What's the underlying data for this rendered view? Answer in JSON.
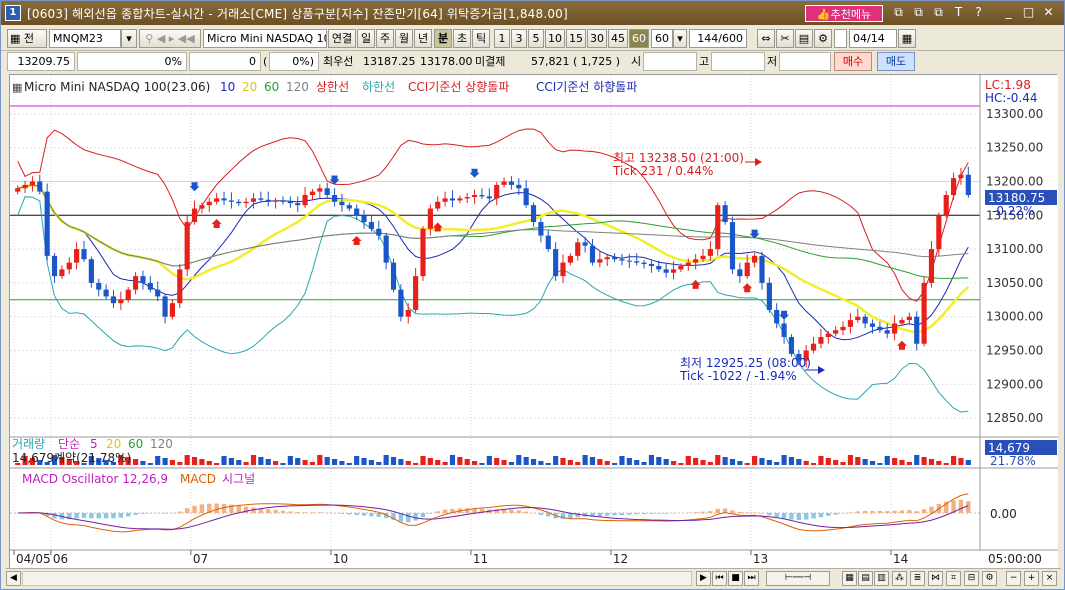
{
  "titlebar": {
    "window_num": "1",
    "title": "[0603] 해외선옵 종합차트-실시간 - 거래소[CME] 상품구분[지수] 잔존만기[64] 위탁증거금[1,848.00]",
    "recommend_label": "추천메뉴",
    "controls": [
      "⧉",
      "⧉",
      "⧉",
      "T",
      "?",
      "_",
      "□",
      "✕"
    ]
  },
  "toolbar": {
    "jeon": "전",
    "symbol": "MNQM23",
    "product_name": "Micro Mini NASDAQ 10",
    "continuous": "연결",
    "periods": [
      "일",
      "주",
      "월",
      "년",
      "분",
      "초",
      "틱"
    ],
    "intervals": [
      "1",
      "3",
      "5",
      "10",
      "15",
      "30",
      "45",
      "60"
    ],
    "selected_interval": "60",
    "interval_value": "60",
    "count": "144/600",
    "date": "04/14"
  },
  "quote": {
    "price": "13209.75",
    "change": "0%",
    "volume": "0",
    "volume_pct": "0%)",
    "paren": "(",
    "best_ask_label": "최우선",
    "best_ask": "13187.25",
    "best_bid": "13178.00",
    "open_int_label": "미결제",
    "open_int": "57,821",
    "oi_change": "( 1,725 )",
    "open_label": "시",
    "high_label": "고",
    "low_label": "저",
    "buy_label": "매수",
    "sell_label": "매도"
  },
  "legend_main": {
    "name": "Micro Mini NASDAQ 100(23.06)",
    "ma": [
      "10",
      "20",
      "60",
      "120"
    ],
    "upper": "상한선",
    "lower": "하한선",
    "cci_up": "CCI기준선 상향돌파",
    "cci_down": "CCI기준선 하향돌파",
    "lc": "LC:1.98",
    "hc": "HC:-0.44"
  },
  "annotations": {
    "high_label": "최고 13238.50 (21:00)",
    "high_tick": "Tick 231 / 0.44%",
    "low_label": "최저 12925.25 (08:00)",
    "low_tick": "Tick -1022 / -1.94%"
  },
  "price_axis": {
    "ticks": [
      "13300.00",
      "13250.00",
      "13200.00",
      "13150.00",
      "13100.00",
      "13050.00",
      "13000.00",
      "12950.00",
      "12900.00",
      "12850.00"
    ],
    "current": "13180.75",
    "current_pct": "-0.22%"
  },
  "volume_panel": {
    "label": "거래량",
    "ma_label": "단순",
    "ma": [
      "5",
      "20",
      "60",
      "120"
    ],
    "info": "14,679계약(21.78%)",
    "axis_value": "14,679",
    "axis_pct": "21.78%"
  },
  "macd_panel": {
    "label": "MACD Oscillator 12,26,9",
    "macd": "MACD",
    "signal": "시그널",
    "axis_value": "0.00"
  },
  "time_axis": {
    "labels": [
      "04/05",
      "06",
      "07",
      "10",
      "11",
      "12",
      "13",
      "14"
    ],
    "right": "05:00:00"
  },
  "colors": {
    "up": "#e8201a",
    "down": "#1a56c8",
    "ma10": "#1a2ab8",
    "ma20": "#f2ef2a",
    "ma60": "#2aa02a",
    "ma120": "#808080",
    "upper_band": "#d81e1e",
    "lower_band": "#2aa6b0"
  },
  "chart_data": {
    "type": "candlestick",
    "title": "Micro Mini NASDAQ 100(23.06)",
    "interval": "60",
    "ylim": [
      12825,
      13325
    ],
    "x_labels": [
      "04/05",
      "06",
      "07",
      "10",
      "11",
      "12",
      "13",
      "14"
    ],
    "close": [
      13190,
      13195,
      13200,
      13185,
      13090,
      13060,
      13070,
      13080,
      13100,
      13085,
      13050,
      13040,
      13030,
      13020,
      13025,
      13040,
      13060,
      13050,
      13040,
      13030,
      13000,
      13020,
      13070,
      13140,
      13160,
      13165,
      13170,
      13175,
      13172,
      13170,
      13168,
      13170,
      13175,
      13173,
      13170,
      13172,
      13170,
      13168,
      13165,
      13180,
      13185,
      13190,
      13180,
      13170,
      13165,
      13160,
      13150,
      13140,
      13130,
      13120,
      13080,
      13040,
      13000,
      13010,
      13060,
      13130,
      13160,
      13170,
      13175,
      13172,
      13175,
      13177,
      13180,
      13178,
      13175,
      13195,
      13200,
      13195,
      13190,
      13165,
      13140,
      13120,
      13100,
      13060,
      13080,
      13090,
      13110,
      13105,
      13080,
      13085,
      13088,
      13085,
      13083,
      13082,
      13080,
      13078,
      13075,
      13070,
      13065,
      13070,
      13075,
      13080,
      13085,
      13090,
      13100,
      13165,
      13140,
      13070,
      13060,
      13080,
      13090,
      13050,
      13010,
      12990,
      12970,
      12945,
      12935,
      12950,
      12960,
      12970,
      12975,
      12980,
      12985,
      12995,
      13000,
      12990,
      12985,
      12980,
      12975,
      12990,
      12995,
      13000,
      12960,
      13050,
      13100,
      13150,
      13180,
      13205,
      13210,
      13180
    ]
  }
}
